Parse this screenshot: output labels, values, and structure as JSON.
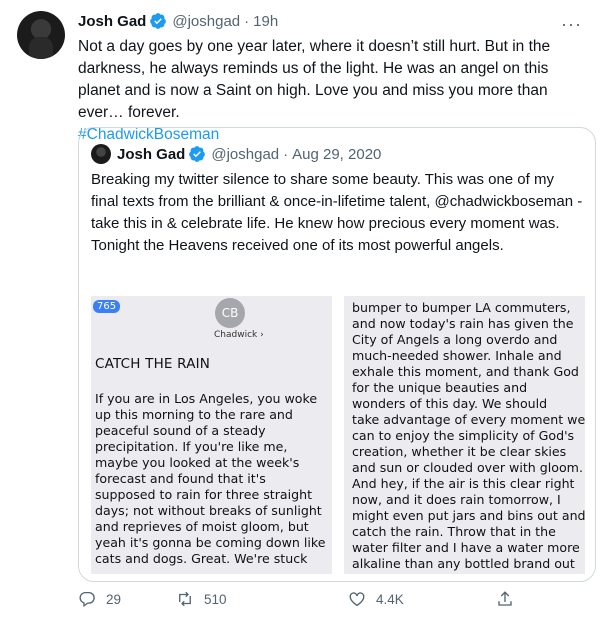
{
  "tweet": {
    "author_name": "Josh Gad",
    "handle": "@joshgad",
    "separator": "·",
    "time": "19h",
    "more": "···",
    "text": "Not a day goes by one year later, where it doesn’t still hurt. But in the darkness, he always reminds us of the light. He was an angel on this planet and is now a Saint on high. Love you and miss you more than ever… forever.",
    "hashtag": "#ChadwickBoseman"
  },
  "quote": {
    "author_name": "Josh Gad",
    "handle": "@joshgad",
    "separator": "·",
    "date": "Aug 29, 2020",
    "text": "Breaking my twitter silence to share some beauty. This was one of my final texts from the brilliant & once-in-lifetime talent, @chadwickboseman - take this in & celebrate life. He knew how precious every moment was. Tonight the Heavens received one of its most powerful angels.",
    "image_left": {
      "badge": "765",
      "avatar_initials": "CB",
      "contact": "Chadwick ›",
      "title": "CATCH THE RAIN",
      "lines": [
        "If you are in Los Angeles, you woke",
        "up this morning to the rare and",
        "peaceful sound of a steady",
        "precipitation.  If you're like me,",
        "maybe you looked at the week's",
        "forecast and found that it's",
        "supposed to rain for three straight",
        "days; not without breaks of sunlight",
        "and reprieves of moist gloom, but",
        "yeah it's gonna be coming down like",
        "cats and dogs.  Great. We're stuck"
      ]
    },
    "image_right": {
      "lines": [
        "bumper to bumper LA commuters,",
        "and now today's rain has given the",
        "City of Angels a long overdo and",
        "much-needed shower.  Inhale and",
        "exhale this moment, and thank God",
        "for the unique beauties and",
        "wonders of this day.  We should",
        "take advantage of every moment we",
        "can to enjoy the simplicity of God's",
        "creation, whether it be clear skies",
        "and sun or clouded over with gloom.",
        "And hey, if the air is this clear right",
        "now, and it does rain tomorrow, I",
        "might even put jars and bins out and",
        "catch the rain.  Throw that in the",
        "water filter and I have a water more",
        "alkaline than any bottled brand out"
      ]
    }
  },
  "actions": {
    "replies": "29",
    "retweets": "510",
    "likes": "4.4K"
  },
  "colors": {
    "accent": "#1d9bf0",
    "secondary_text": "#536471",
    "border": "#cfd9de"
  },
  "icons": [
    "verified-badge-icon",
    "more-icon",
    "reply-icon",
    "retweet-icon",
    "like-icon",
    "share-icon"
  ]
}
